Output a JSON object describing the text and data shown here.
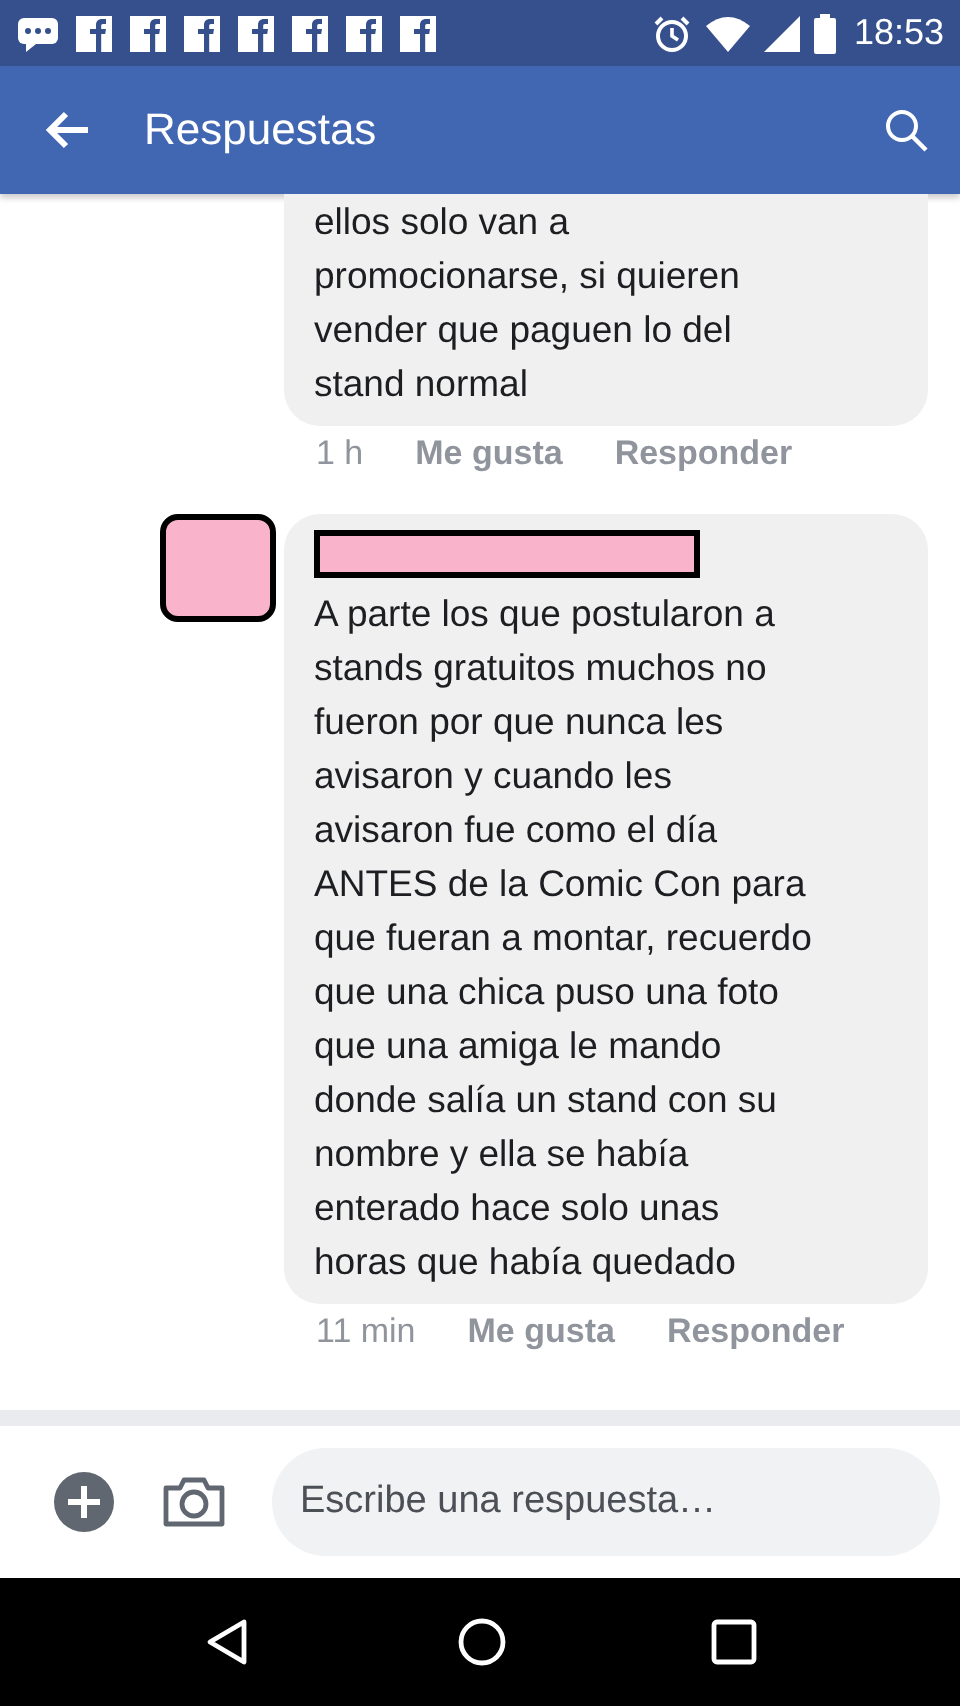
{
  "status_bar": {
    "time": "18:53"
  },
  "header": {
    "title": "Respuestas"
  },
  "replies": [
    {
      "author_redacted": false,
      "text": "ellos solo van a\npromocionarse, si quieren\nvender que paguen lo del\nstand normal",
      "time": "1 h",
      "actions": [
        "Me gusta",
        "Responder"
      ]
    },
    {
      "author_redacted": true,
      "text": "A parte los que postularon a\nstands gratuitos muchos no\nfueron por que nunca les\navisaron y cuando les\navisaron fue como el día\nANTES de la Comic Con para\nque fueran a montar, recuerdo\nque una chica puso una foto\nque una amiga le mando\ndonde salía un stand con su\nnombre y ella se había\nenterado hace solo unas\nhoras que había quedado",
      "time": "11 min",
      "actions": [
        "Me gusta",
        "Responder"
      ]
    }
  ],
  "composer": {
    "placeholder": "Escribe una respuesta…"
  }
}
